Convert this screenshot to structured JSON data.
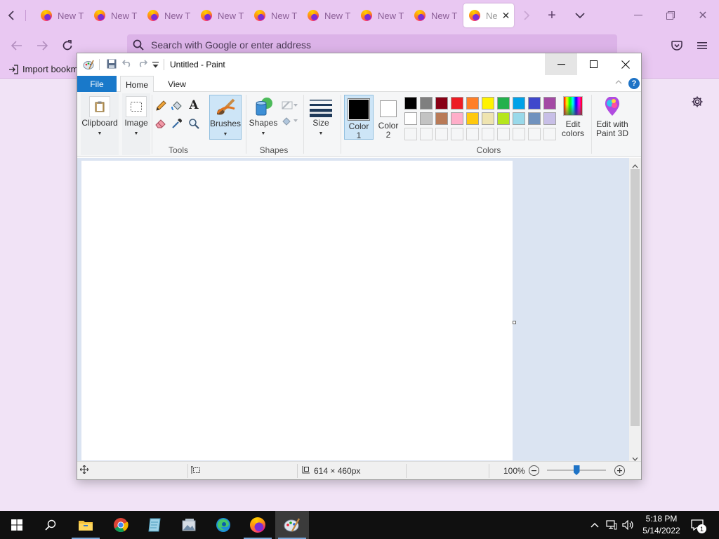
{
  "browser": {
    "tabs": [
      {
        "label": "New T"
      },
      {
        "label": "New T"
      },
      {
        "label": "New T"
      },
      {
        "label": "New T"
      },
      {
        "label": "New T"
      },
      {
        "label": "New T"
      },
      {
        "label": "New T"
      },
      {
        "label": "New T"
      }
    ],
    "active_tab": {
      "label": "Ne"
    },
    "address_placeholder": "Search with Google or enter address",
    "bookmark_label": "Import bookm"
  },
  "paint": {
    "window_title": "Untitled - Paint",
    "tabs": {
      "file": "File",
      "home": "Home",
      "view": "View"
    },
    "groups": {
      "tools": "Tools",
      "shapes": "Shapes",
      "colors": "Colors"
    },
    "buttons": {
      "clipboard": "Clipboard",
      "image": "Image",
      "brushes": "Brushes",
      "shapes": "Shapes",
      "size": "Size",
      "color1_line1": "Color",
      "color1_line2": "1",
      "color2_line1": "Color",
      "color2_line2": "2",
      "edit_colors_line1": "Edit",
      "edit_colors_line2": "colors",
      "paint3d_line1": "Edit with",
      "paint3d_line2": "Paint 3D"
    },
    "color1": "#000000",
    "color2": "#ffffff",
    "palette_row1": [
      "#000000",
      "#7f7f7f",
      "#880015",
      "#ed1c24",
      "#ff7f27",
      "#fff200",
      "#22b14c",
      "#00a2e8",
      "#3f48cc",
      "#a349a4"
    ],
    "palette_row2": [
      "#ffffff",
      "#c3c3c3",
      "#b97a57",
      "#ffaec9",
      "#ffc90e",
      "#efe4b0",
      "#b5e61d",
      "#99d9ea",
      "#7092be",
      "#c8bfe7"
    ],
    "status": {
      "canvas_size": "614 × 460px",
      "zoom": "100%",
      "zoom_level": 0.5
    }
  },
  "taskbar": {
    "apps": [
      "start",
      "search",
      "file-explorer",
      "chrome",
      "notepad",
      "photos",
      "edge",
      "firefox",
      "paint"
    ],
    "time": "5:18 PM",
    "date": "5/14/2022",
    "notification_count": "1"
  }
}
